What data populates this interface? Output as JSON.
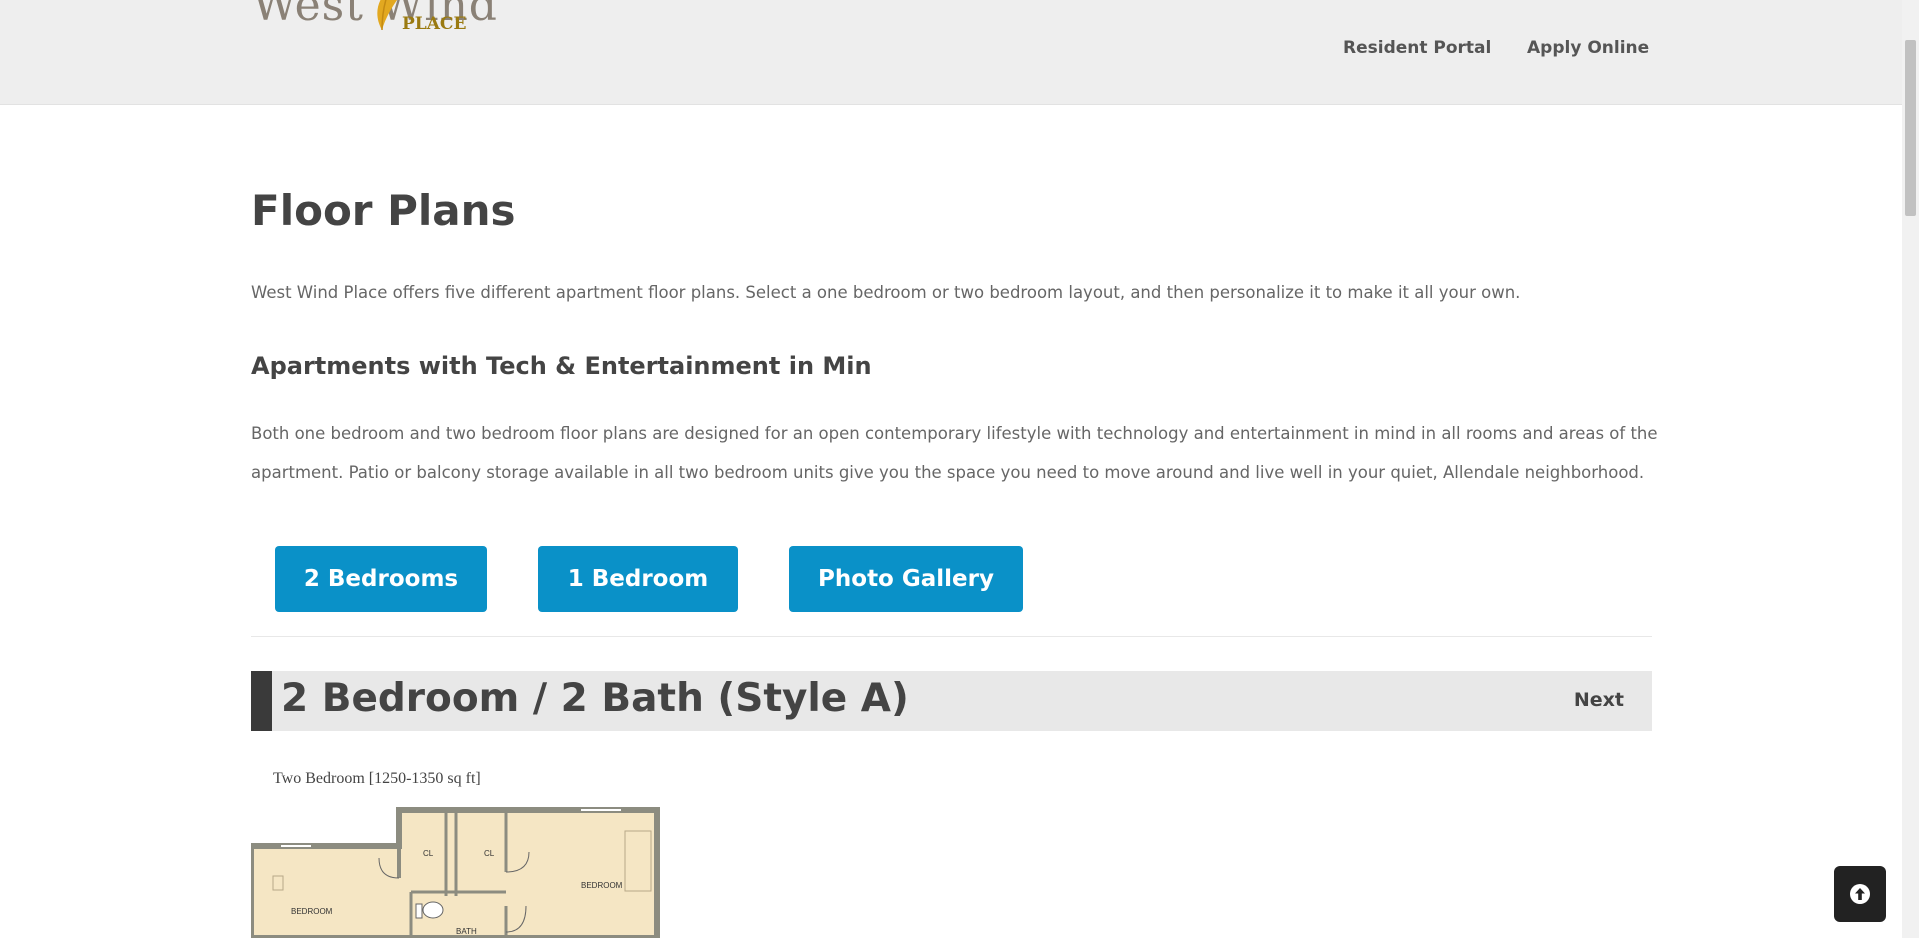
{
  "header": {
    "logo_top": "West Wind",
    "logo_bottom": "PLACE",
    "nav": [
      {
        "label": "Resident Portal"
      },
      {
        "label": "Apply Online"
      }
    ]
  },
  "main": {
    "title": "Floor Plans",
    "intro": "West Wind Place offers five different apartment floor plans. Select a one bedroom or two bedroom layout, and then personalize it to make it all your own.",
    "subheading": "Apartments with Tech & Entertainment in Min",
    "body": "Both one bedroom and two bedroom floor plans are designed for an open contemporary lifestyle with technology and entertainment in mind in all rooms and areas of the apartment. Patio or balcony storage available in all two bedroom units give you the space you need to move around and live well in your quiet, Allendale neighborhood.",
    "filters": [
      {
        "label": "2 Bedrooms"
      },
      {
        "label": "1 Bedroom"
      },
      {
        "label": "Photo Gallery"
      }
    ]
  },
  "plan": {
    "title": "2 Bedroom / 2 Bath (Style A)",
    "next_label": "Next",
    "caption": "Two Bedroom [1250-1350 sq ft]",
    "room_labels": {
      "bedroom_left": "BEDROOM",
      "bedroom_right": "BEDROOM",
      "closet_1": "CL",
      "closet_2": "CL",
      "bath": "BATH"
    }
  },
  "colors": {
    "header_bg": "#eeeeee",
    "button_bg": "#0a91c8",
    "plan_header_bg": "#e8e8e8",
    "plan_accent": "#3a3a3a",
    "floorplan_fill": "#f5e6c4",
    "floorplan_wall": "#8c8c80"
  },
  "icons": {
    "back_to_top": "arrow-up-circle-icon",
    "logo_leaf": "leaf-icon"
  }
}
